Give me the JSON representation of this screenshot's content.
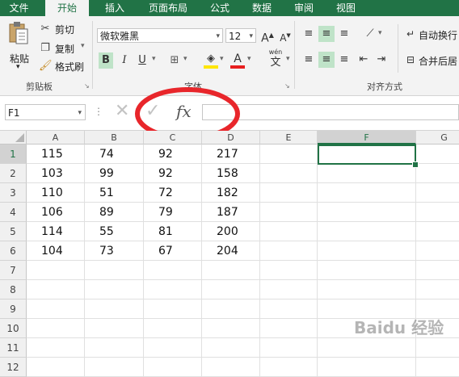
{
  "tabs": [
    "文件",
    "开始",
    "插入",
    "页面布局",
    "公式",
    "数据",
    "审阅",
    "视图"
  ],
  "clipboard": {
    "paste": "粘贴",
    "cut": "剪切",
    "copy": "复制",
    "format_painter": "格式刷",
    "group_label": "剪贴板"
  },
  "font": {
    "name": "微软雅黑",
    "size": "12",
    "group_label": "字体",
    "bold": "B",
    "italic": "I",
    "underline": "U",
    "grow": "A",
    "shrink": "A",
    "font_color_letter": "A",
    "wen": "wén",
    "wen_char": "文"
  },
  "alignment": {
    "wrap": "自动换行",
    "merge": "合并后居",
    "group_label": "对齐方式"
  },
  "formula_bar": {
    "name_box": "F1",
    "fx": "fx",
    "value": ""
  },
  "columns": [
    "A",
    "B",
    "C",
    "D",
    "E",
    "F",
    "G"
  ],
  "rows": [
    "1",
    "2",
    "3",
    "4",
    "5",
    "6",
    "7",
    "8",
    "9",
    "10",
    "11",
    "12"
  ],
  "table": [
    [
      "115",
      "74",
      "92",
      "217"
    ],
    [
      "103",
      "99",
      "92",
      "158"
    ],
    [
      "110",
      "51",
      "72",
      "182"
    ],
    [
      "106",
      "89",
      "79",
      "187"
    ],
    [
      "114",
      "55",
      "81",
      "200"
    ],
    [
      "104",
      "73",
      "67",
      "204"
    ]
  ],
  "selected_cell": "F1",
  "colors": {
    "accent": "#217346",
    "annotation": "#e8262b"
  },
  "watermark": "Baidu 经验"
}
